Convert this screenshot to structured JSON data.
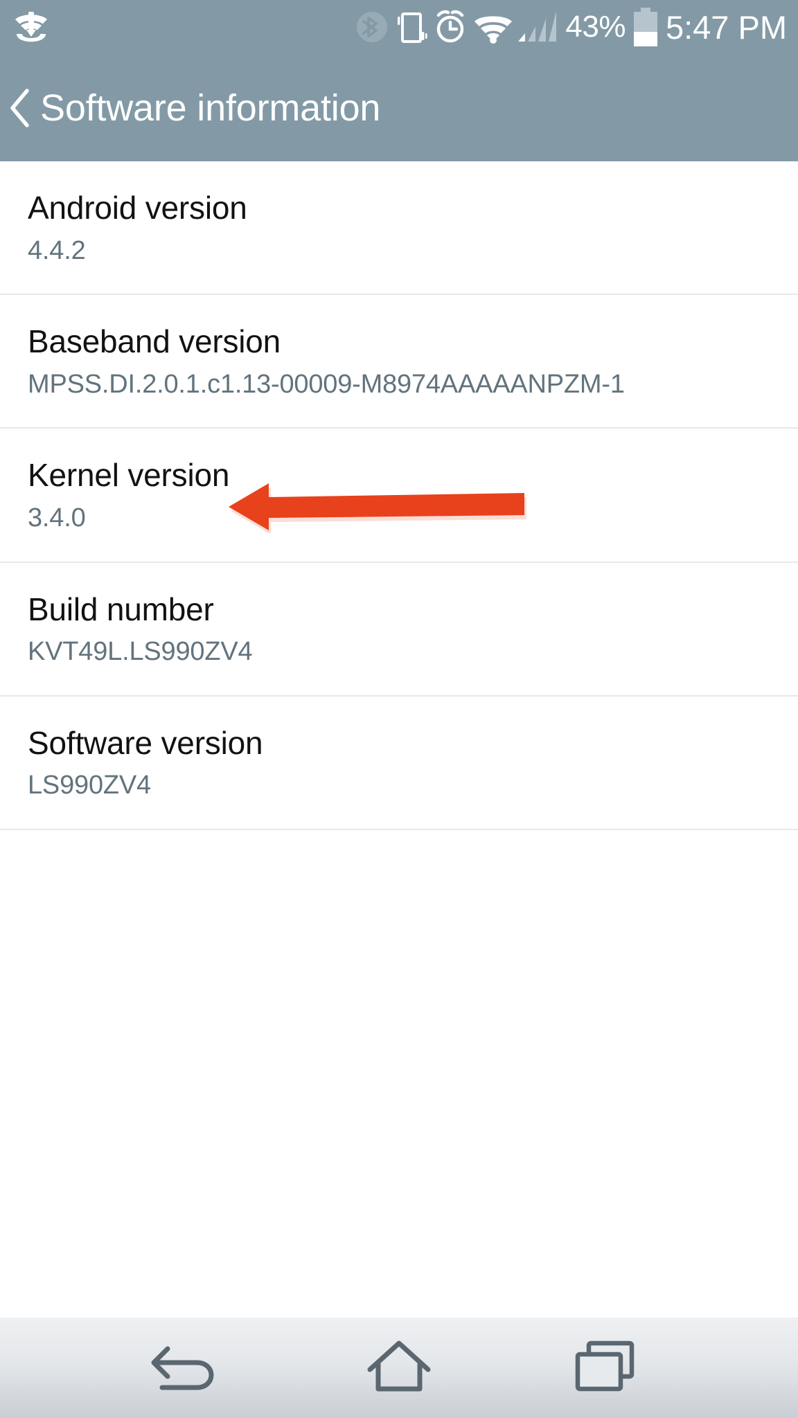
{
  "statusbar": {
    "icons": [
      {
        "name": "wifi-calling-icon",
        "label": "WiFi calling"
      },
      {
        "name": "bluetooth-icon",
        "label": "Bluetooth (inactive)"
      },
      {
        "name": "vibrate-mode-icon",
        "label": "Vibrate mode"
      },
      {
        "name": "alarm-clock-icon",
        "label": "Alarm set"
      },
      {
        "name": "wifi-signal-icon",
        "label": "Wi-Fi connected"
      },
      {
        "name": "cellular-signal-icon",
        "label": "Cellular signal"
      }
    ],
    "battery_percent": "43%",
    "battery_level": 43,
    "time": "5:47 PM"
  },
  "header": {
    "back_label": "‹",
    "title": "Software information"
  },
  "list": {
    "rows": [
      {
        "label": "Android version",
        "value": "4.4.2"
      },
      {
        "label": "Baseband version",
        "value": "MPSS.DI.2.0.1.c1.13-00009-M8974AAAAANPZM-1"
      },
      {
        "label": "Kernel version",
        "value": "3.4.0"
      },
      {
        "label": "Build number",
        "value": "KVT49L.LS990ZV4"
      },
      {
        "label": "Software version",
        "value": "LS990ZV4"
      }
    ]
  },
  "annotation": {
    "type": "arrow",
    "points_to": "Build number",
    "direction": "left",
    "color": "#e8421d"
  },
  "navbar": {
    "buttons": [
      {
        "name": "nav-back-button",
        "label": "Back"
      },
      {
        "name": "nav-home-button",
        "label": "Home"
      },
      {
        "name": "nav-recents-button",
        "label": "Recent apps"
      }
    ]
  },
  "colors": {
    "status_bar": "#839aa6",
    "header": "#839aa6",
    "label_text": "#121212",
    "value_text": "#62737d",
    "divider": "#e8e8e8",
    "accent_arrow": "#e8421d",
    "nav_icon": "#5a6670"
  }
}
